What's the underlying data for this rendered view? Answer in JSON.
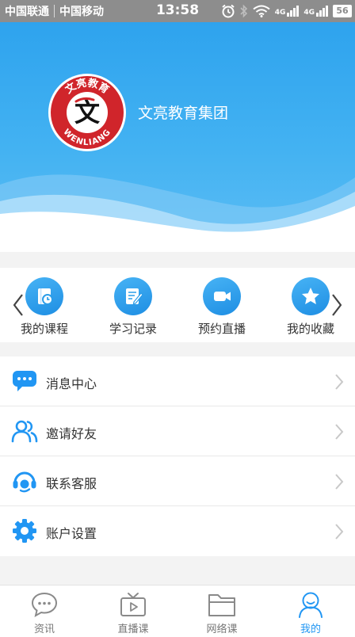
{
  "status_bar": {
    "carrier1": "中国联通",
    "carrier2": "中国移动",
    "time": "13:58",
    "signal1_label": "4G",
    "signal2_label": "4G",
    "battery": "56"
  },
  "header": {
    "logo_arc_text": "文亮教育",
    "logo_center_char": "文",
    "logo_bottom_text": "WENLIANG",
    "org_name": "文亮教育集团"
  },
  "shortcuts": [
    {
      "label": "我的课程",
      "icon": "book-clock-icon"
    },
    {
      "label": "学习记录",
      "icon": "notepad-pen-icon"
    },
    {
      "label": "预约直播",
      "icon": "video-camera-icon"
    },
    {
      "label": "我的收藏",
      "icon": "star-icon"
    }
  ],
  "menu": [
    {
      "label": "消息中心",
      "icon": "chat-bubbles-icon"
    },
    {
      "label": "邀请好友",
      "icon": "users-icon"
    },
    {
      "label": "联系客服",
      "icon": "headset-icon"
    },
    {
      "label": "账户设置",
      "icon": "gear-icon"
    }
  ],
  "tabs": [
    {
      "label": "资讯",
      "icon": "chat-bubble-icon",
      "active": false
    },
    {
      "label": "直播课",
      "icon": "tv-icon",
      "active": false
    },
    {
      "label": "网络课",
      "icon": "folder-icon",
      "active": false
    },
    {
      "label": "我的",
      "icon": "person-icon",
      "active": true
    }
  ],
  "colors": {
    "accent": "#2196f3",
    "header_blue": "#3aabf0",
    "status_bar": "#8d8d8d",
    "logo_red": "#d0252b"
  }
}
